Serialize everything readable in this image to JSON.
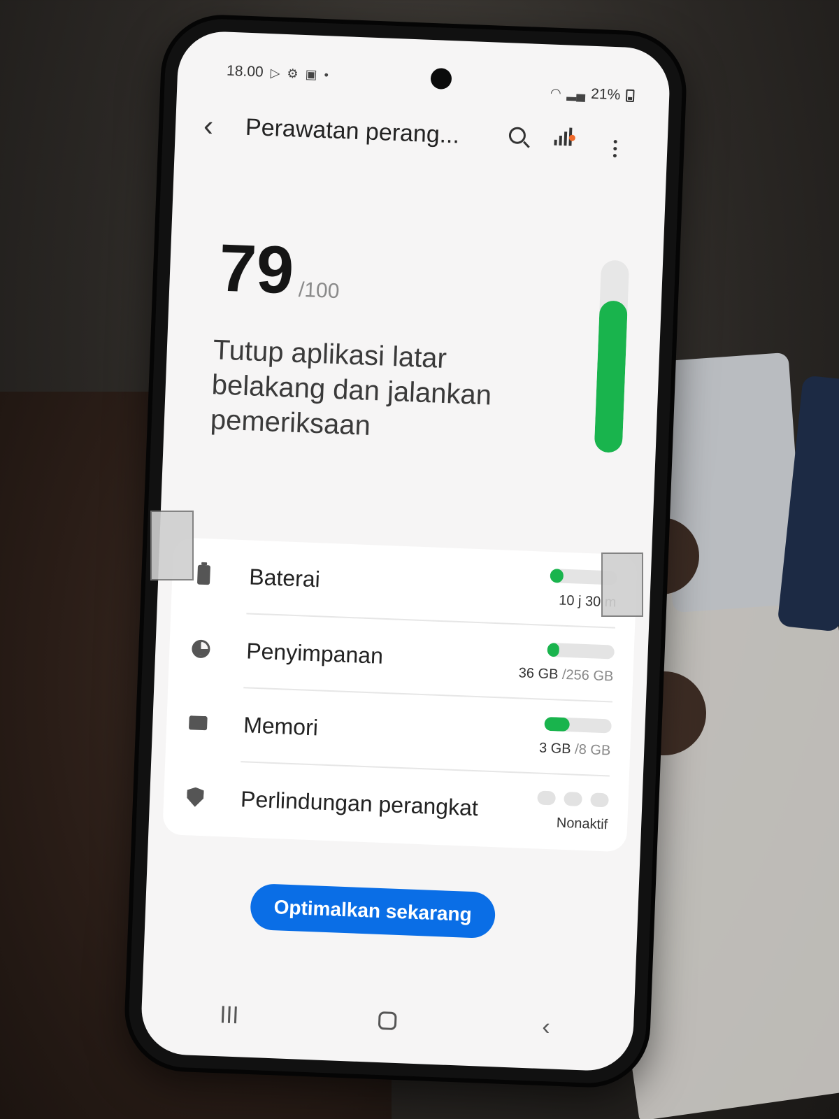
{
  "status_bar": {
    "time": "18.00",
    "battery_percent": "21%"
  },
  "app_bar": {
    "title": "Perawatan perang..."
  },
  "score": {
    "value": "79",
    "max": "/100",
    "message": "Tutup aplikasi latar belakang dan jalankan pemeriksaan",
    "gauge_fraction": 0.79
  },
  "items": [
    {
      "label": "Baterai",
      "value": "10 j 30 m",
      "value_muted": "",
      "fill": 0.2,
      "icon": "battery-icon"
    },
    {
      "label": "Penyimpanan",
      "value": "36 GB",
      "value_muted": "/256 GB",
      "fill": 0.14,
      "icon": "storage-pie-icon"
    },
    {
      "label": "Memori",
      "value": "3 GB",
      "value_muted": "/8 GB",
      "fill": 0.375,
      "icon": "memory-chip-icon"
    },
    {
      "label": "Perlindungan perangkat",
      "value": "Nonaktif",
      "value_muted": "",
      "fill": 0,
      "icon": "shield-icon"
    }
  ],
  "primary_button": {
    "label": "Optimalkan sekarang"
  },
  "colors": {
    "accent": "#0a6ee6",
    "good": "#19b44d",
    "notification_dot": "#f06a2a"
  }
}
